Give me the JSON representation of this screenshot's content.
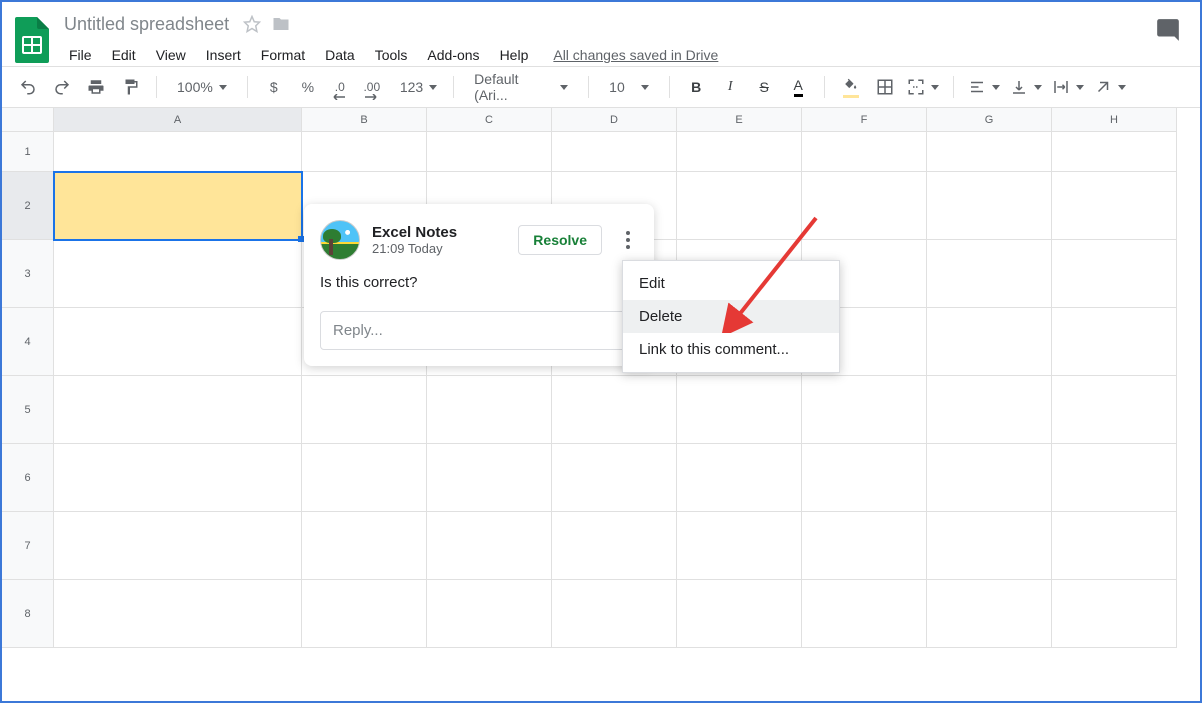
{
  "header": {
    "title": "Untitled spreadsheet",
    "save_status": "All changes saved in Drive"
  },
  "menu": {
    "items": [
      "File",
      "Edit",
      "View",
      "Insert",
      "Format",
      "Data",
      "Tools",
      "Add-ons",
      "Help"
    ]
  },
  "toolbar": {
    "zoom": "100%",
    "currency": "$",
    "percent": "%",
    "dec_dec": ".0",
    "inc_dec": ".00",
    "numfmt": "123",
    "font": "Default (Ari...",
    "font_size": "10",
    "bold": "B",
    "italic": "I",
    "strike": "S",
    "text_color": "A"
  },
  "grid": {
    "cols": [
      "A",
      "B",
      "C",
      "D",
      "E",
      "F",
      "G",
      "H"
    ],
    "rows": [
      "1",
      "2",
      "3",
      "4",
      "5",
      "6",
      "7",
      "8"
    ],
    "selected_row": "2",
    "selected_col": "A"
  },
  "comment": {
    "author": "Excel Notes",
    "time": "21:09 Today",
    "body": "Is this correct?",
    "resolve_label": "Resolve",
    "reply_placeholder": "Reply..."
  },
  "ctx": {
    "edit": "Edit",
    "delete": "Delete",
    "link": "Link to this comment..."
  }
}
